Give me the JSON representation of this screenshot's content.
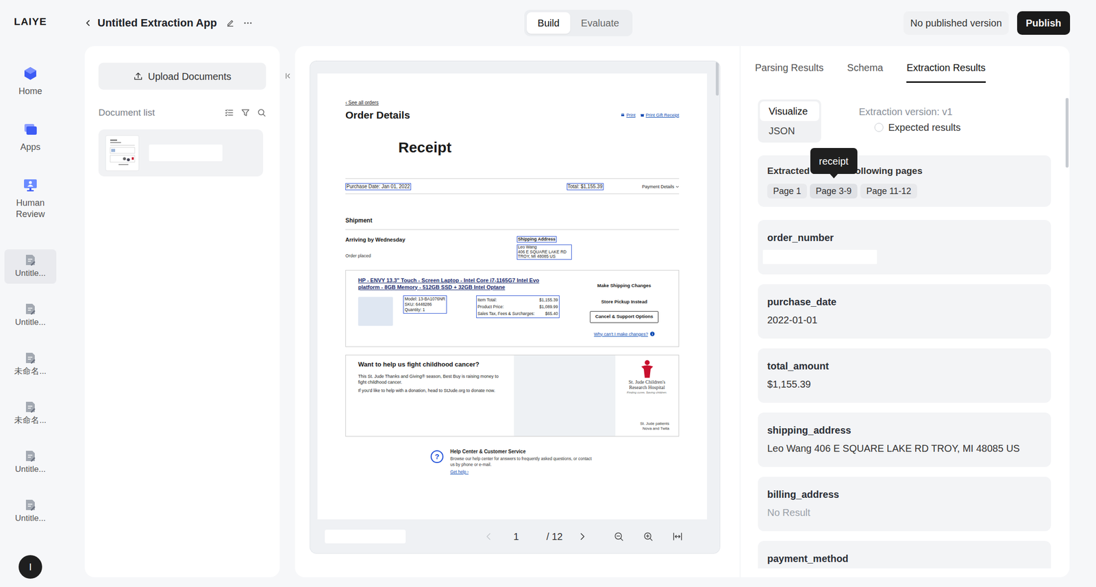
{
  "brand": {
    "logo": "LAIYE"
  },
  "nav": {
    "main": [
      {
        "label": "Home",
        "selected": false
      },
      {
        "label": "Apps",
        "selected": false
      },
      {
        "label": "Human Review",
        "selected": false
      }
    ],
    "apps": [
      {
        "label": "Untitle...",
        "selected": true
      },
      {
        "label": "Untitle...",
        "selected": false
      },
      {
        "label": "未命名...",
        "selected": false
      },
      {
        "label": "未命名...",
        "selected": false
      },
      {
        "label": "Untitle...",
        "selected": false
      },
      {
        "label": "Untitle...",
        "selected": false
      }
    ],
    "avatar": "I"
  },
  "header": {
    "title": "Untitled Extraction App",
    "modes": [
      {
        "label": "Build",
        "selected": true
      },
      {
        "label": "Evaluate",
        "selected": false
      }
    ],
    "status": "No published version",
    "publish": "Publish"
  },
  "documents": {
    "upload": "Upload Documents",
    "title": "Document list",
    "items": [
      {
        "redacted": true,
        "selected": true
      }
    ]
  },
  "viewer": {
    "page": "1",
    "total": "/ 12",
    "prev_disabled": true,
    "next_disabled": false,
    "field_redacted": true
  },
  "doc": {
    "back": "‹ See all orders",
    "title": "Order Details",
    "print": "Print",
    "gift": "Print Gift Receipt",
    "heading": "Receipt",
    "purchase_date": {
      "text": "Purchase Date: Jan 01, 2022",
      "highlighted": true
    },
    "total": {
      "text": "Total: $1,155.39",
      "highlighted": true
    },
    "payment": "Payment Details",
    "shipment": "Shipment",
    "arriving": "Arriving by Wednesday",
    "placed": "Order placed",
    "ship_label": {
      "text": "Shipping Address",
      "highlighted": true
    },
    "ship_address": {
      "lines": [
        "Leo Wang",
        "406 E SQUARE LAKE RD",
        "TROY, MI 48085 US"
      ],
      "highlighted": true
    },
    "product": {
      "title": "HP - ENVY 13.3\" Touch - Screen Laptop - Intel Core i7-1165G7 Intel Evo platform - 8GB Memory - 512GB SSD + 32GB Intel Optane",
      "specs": {
        "lines": [
          "Model: 13-BA1076NR",
          "SKU: 6448286",
          "Quantity: 1"
        ],
        "highlighted": true
      },
      "prices": {
        "rows": [
          {
            "label": "Item Total:",
            "value": "$1,155.39"
          },
          {
            "label": "Product Price:",
            "value": "$1,089.99"
          },
          {
            "label": "Sales Tax, Fees & Surcharges:",
            "value": "$65.40"
          }
        ],
        "highlighted": true
      },
      "actions": [
        {
          "label": "Make Shipping Changes",
          "kind": "plain"
        },
        {
          "label": "Store Pickup Instead",
          "kind": "plain"
        },
        {
          "label": "Cancel & Support Options",
          "kind": "outlined"
        }
      ],
      "help_link": "Why can't I make changes?"
    },
    "promo": {
      "title": "Want to help us fight childhood cancer?",
      "lines": [
        "This St. Jude Thanks and Giving® season, Best Buy is raising money to fight childhood cancer.",
        "If you'd like to help with a donation, head to StJude.org to donate now."
      ],
      "logo_lines": [
        "St. Jude Children's",
        "Research Hospital"
      ],
      "tagline": "Finding cures. Saving children.",
      "caption_lines": [
        "St. Jude patients",
        "Nova and Twila"
      ]
    },
    "help": {
      "icon": "?",
      "title": "Help Center & Customer Service",
      "text": "Browse our help center for answers to frequently asked questions, or contact us by phone or e-mail.",
      "link": "Get help ›"
    }
  },
  "results": {
    "tabs": [
      {
        "label": "Parsing Results",
        "selected": false
      },
      {
        "label": "Schema",
        "selected": false
      },
      {
        "label": "Extraction Results",
        "selected": true
      }
    ],
    "views": [
      {
        "label": "Visualize",
        "selected": true
      },
      {
        "label": "JSON",
        "selected": false
      }
    ],
    "version": "Extraction version: v1",
    "expected": {
      "label": "Expected results",
      "checked": false
    },
    "pages": {
      "title": "Extracted from the following pages",
      "chips": [
        {
          "label": "Page 1",
          "hovered": false
        },
        {
          "label": "Page 3-9",
          "hovered": true
        },
        {
          "label": "Page 11-12",
          "hovered": false
        }
      ],
      "tooltip": "receipt"
    },
    "fields": [
      {
        "name": "order_number",
        "kind": "redacted"
      },
      {
        "name": "purchase_date",
        "kind": "text",
        "value": "2022-01-01"
      },
      {
        "name": "total_amount",
        "kind": "text",
        "value": "$1,155.39"
      },
      {
        "name": "shipping_address",
        "kind": "text",
        "value": "Leo Wang 406 E SQUARE LAKE RD TROY, MI 48085 US"
      },
      {
        "name": "billing_address",
        "kind": "empty",
        "value": "No Result"
      },
      {
        "name": "payment_method",
        "kind": "clipped"
      }
    ]
  }
}
